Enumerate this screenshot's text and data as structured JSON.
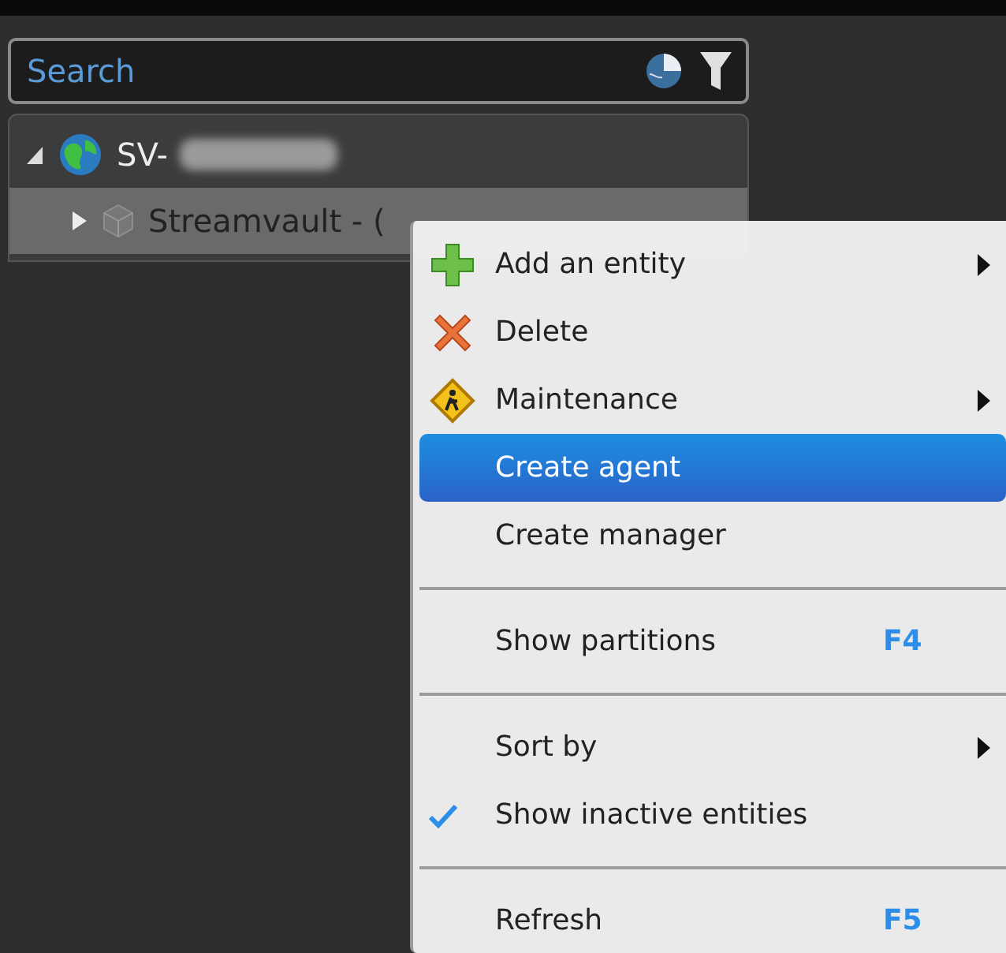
{
  "search": {
    "placeholder": "Search"
  },
  "tree": [
    {
      "label": "SV-",
      "redacted": true,
      "expanded": true,
      "selected": false,
      "children": [
        {
          "label": "Streamvault - (",
          "redacted": false,
          "expanded": false,
          "selected": true
        }
      ]
    }
  ],
  "context_menu": [
    {
      "kind": "item",
      "label": "Add an entity",
      "submenu": true,
      "selected": false
    },
    {
      "kind": "item",
      "label": "Delete",
      "submenu": false,
      "selected": false
    },
    {
      "kind": "item",
      "label": "Maintenance",
      "submenu": true,
      "selected": false
    },
    {
      "kind": "item",
      "label": "Create agent",
      "submenu": false,
      "selected": true
    },
    {
      "kind": "item",
      "label": "Create manager",
      "submenu": false,
      "selected": false
    },
    {
      "kind": "separator"
    },
    {
      "kind": "item",
      "label": "Show partitions",
      "shortcut": "F4",
      "submenu": false,
      "selected": false
    },
    {
      "kind": "separator"
    },
    {
      "kind": "item",
      "label": "Sort by",
      "submenu": true,
      "selected": false
    },
    {
      "kind": "item",
      "label": "Show inactive entities",
      "checked": true,
      "submenu": false,
      "selected": false
    },
    {
      "kind": "separator"
    },
    {
      "kind": "item",
      "label": "Refresh",
      "shortcut": "F5",
      "submenu": false,
      "selected": false
    }
  ]
}
